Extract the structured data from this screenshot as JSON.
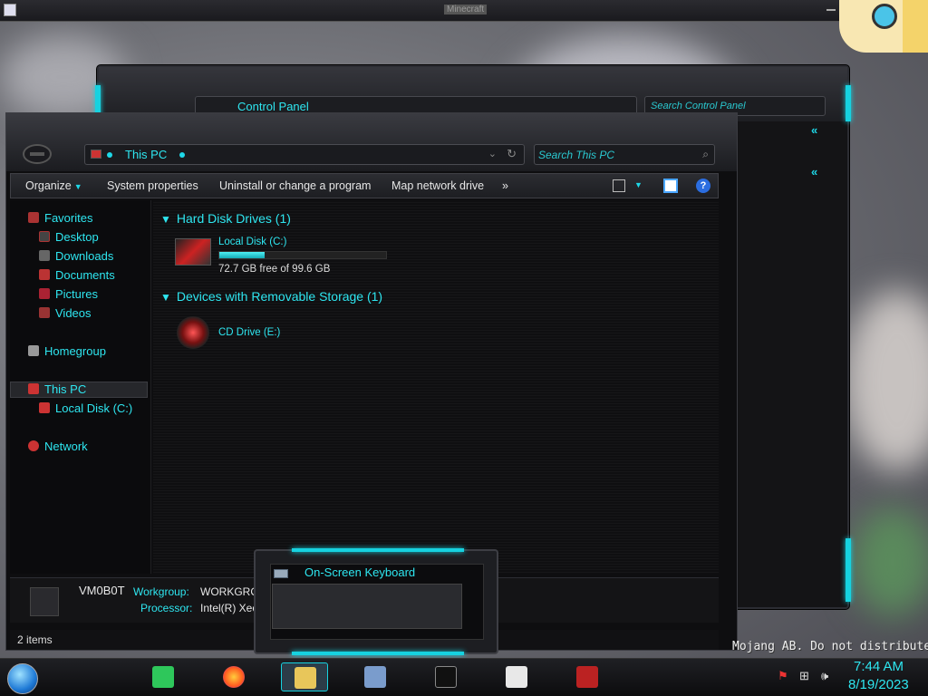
{
  "topbar": {
    "title": "Minecraft"
  },
  "back_window": {
    "address": "Control Panel",
    "search_placeholder": "Search Control Panel"
  },
  "window": {
    "address": "This PC",
    "search_placeholder": "Search This PC",
    "toolbar": {
      "organize": "Organize",
      "system_properties": "System properties",
      "uninstall": "Uninstall or change a program",
      "map_drive": "Map network drive",
      "more": "»"
    },
    "nav": {
      "favorites": "Favorites",
      "desktop": "Desktop",
      "downloads": "Downloads",
      "documents": "Documents",
      "pictures": "Pictures",
      "videos": "Videos",
      "homegroup": "Homegroup",
      "this_pc": "This PC",
      "local_disk": "Local Disk (C:)",
      "network": "Network"
    },
    "groups": {
      "hdd": "Hard Disk Drives (1)",
      "removable": "Devices with Removable Storage (1)"
    },
    "drives": {
      "c_name": "Local Disk (C:)",
      "c_free": "72.7 GB free of 99.6 GB",
      "c_used_fraction": 0.27,
      "e_name": "CD Drive (E:)"
    },
    "details": {
      "pc_name": "VM0B0T",
      "workgroup_label": "Workgroup:",
      "workgroup_value": "WORKGROU",
      "processor_label": "Processor:",
      "processor_value": "Intel(R) Xeon"
    },
    "status": {
      "items": "2 items"
    }
  },
  "osk": {
    "title": "On-Screen Keyboard"
  },
  "taskbar": {
    "time": "7:44 AM",
    "date": "8/19/2023"
  },
  "watermark": "Mojang AB. Do not distribute!",
  "colors": {
    "accent": "#2ee6f0",
    "glow": "#16d2e0"
  }
}
